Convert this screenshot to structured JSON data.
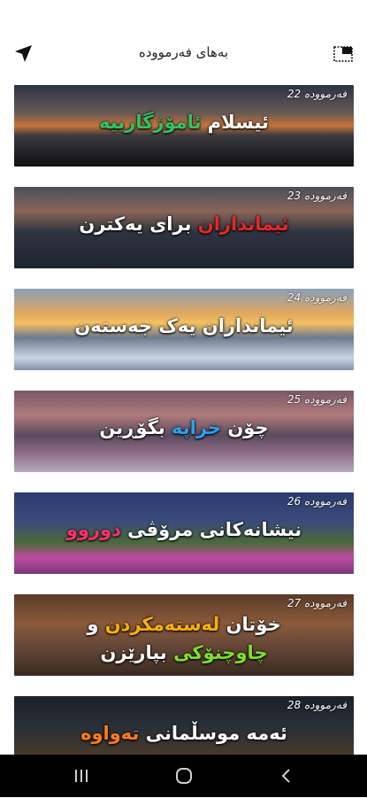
{
  "header": {
    "title": "بەهای فەرموودە",
    "back_icon": "navigation-arrow-icon",
    "view_icon": "picture-in-picture-icon"
  },
  "cards": [
    {
      "number": "فەرموودە 22",
      "line1": [
        {
          "t": "ئیسلام ",
          "c": "#ffffff"
        },
        {
          "t": "ئامۆژگارییە",
          "c": "#2ec36a"
        }
      ],
      "line2": [],
      "image": "mountain-lake-sunset"
    },
    {
      "number": "فەرموودە 23",
      "line1": [
        {
          "t": "ئیمانداران ",
          "c": "#e8262a"
        },
        {
          "t": "برای یەکترن",
          "c": "#ffffff"
        }
      ],
      "line2": [],
      "image": "rocky-mountains-twilight"
    },
    {
      "number": "فەرموودە 24",
      "line1": [
        {
          "t": "ئیمانداران یەک جەستەن",
          "c": "#ffffff"
        }
      ],
      "line2": [],
      "image": "ice-blocks-sunset"
    },
    {
      "number": "فەرموودە 25",
      "line1": [
        {
          "t": "چۆن ",
          "c": "#ffffff"
        },
        {
          "t": "خراپە ",
          "c": "#2aa0f0"
        },
        {
          "t": "بگۆڕین",
          "c": "#ffffff"
        }
      ],
      "line2": [],
      "image": "snowy-peaks-lake"
    },
    {
      "number": "فەرموودە 26",
      "line1": [
        {
          "t": "نیشانەکانی مرۆڤی ",
          "c": "#ffffff"
        },
        {
          "t": "دوروو",
          "c": "#ff3070"
        }
      ],
      "line2": [],
      "image": "pink-flower-meadow"
    },
    {
      "number": "فەرموودە 27",
      "line1": [
        {
          "t": "خۆتان ",
          "c": "#ffffff"
        },
        {
          "t": "لەستەمکردن ",
          "c": "#ffb000"
        },
        {
          "t": "و",
          "c": "#ffffff"
        }
      ],
      "line2": [
        {
          "t": "چاوچنۆکی ",
          "c": "#7ee02a"
        },
        {
          "t": "بپارێزن",
          "c": "#ffffff"
        }
      ],
      "image": "dry-grass-sunset"
    },
    {
      "number": "فەرموودە 28",
      "line1": [
        {
          "t": "ئەمە موسڵمانی ",
          "c": "#ffffff"
        },
        {
          "t": "تەواوە",
          "c": "#ff7a1a"
        }
      ],
      "line2": [],
      "image": "field-dusk"
    }
  ],
  "navbar": {
    "recents_icon": "recents-icon",
    "home_icon": "home-icon",
    "back_icon": "back-icon"
  }
}
